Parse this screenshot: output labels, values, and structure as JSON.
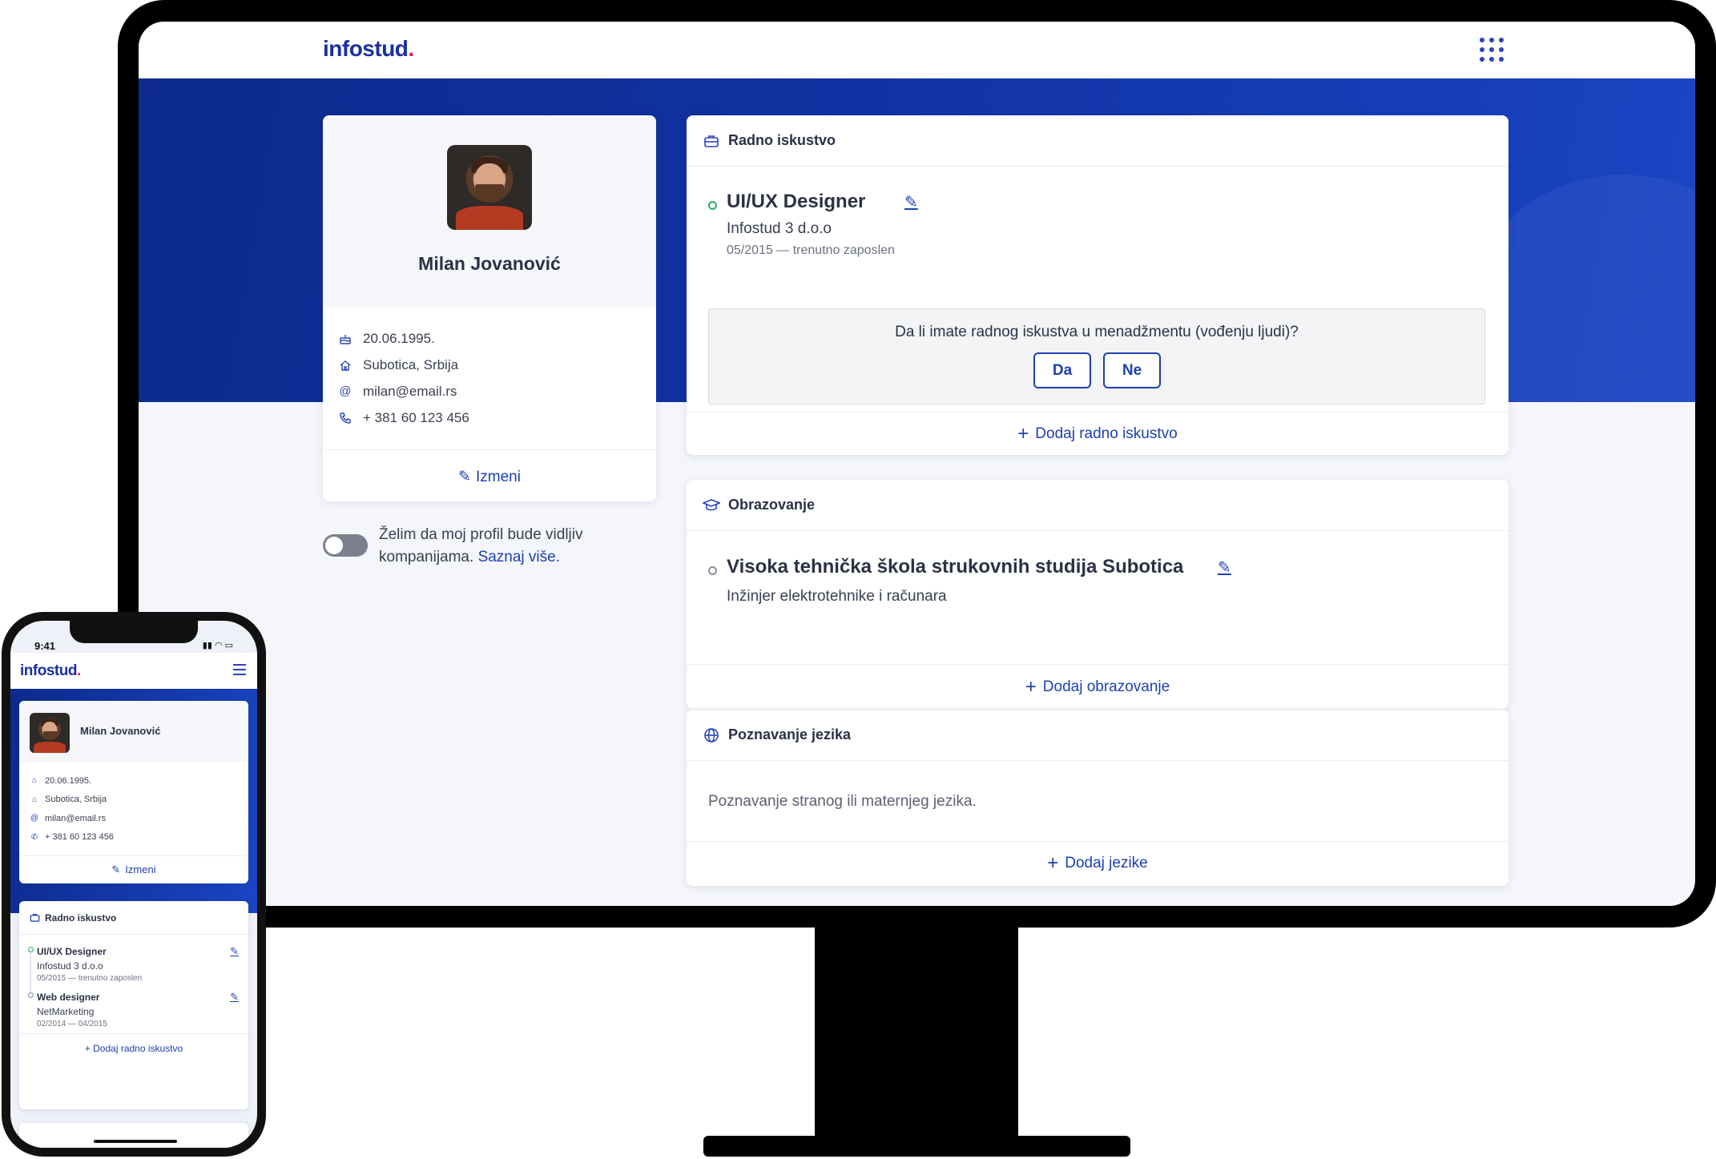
{
  "brand": {
    "logo_text": "infostud",
    "logo_dot": ".",
    "logo_color": "#1b2fa3",
    "dot_color": "#e5195a"
  },
  "colors": {
    "hero_start": "#0d2a8c",
    "hero_end": "#1a45c4",
    "link": "#1e3fb0",
    "current_bullet": "#29b061"
  },
  "desktop": {
    "topbar": {
      "menu_icon": "apps-grid-icon"
    },
    "profile": {
      "name": "Milan Jovanović",
      "avatar_icon": "profile-photo",
      "info": [
        {
          "icon": "cake-icon",
          "value": "20.06.1995."
        },
        {
          "icon": "home-icon",
          "value": "Subotica, Srbija"
        },
        {
          "icon": "at-icon",
          "value": "milan@email.rs"
        },
        {
          "icon": "phone-icon",
          "value": "+ 381 60 123 456"
        }
      ],
      "edit_label": "Izmeni"
    },
    "visibility": {
      "text": "Želim da moj profil bude vidljiv kompanijama.",
      "link": "Saznaj više.",
      "enabled": false
    },
    "work": {
      "heading": "Radno iskustvo",
      "icon": "briefcase-icon",
      "items": [
        {
          "title": "UI/UX Designer",
          "company": "Infostud 3 d.o.o",
          "period": "05/2015 — trenutno zaposlen"
        }
      ],
      "question": "Da li imate radnog iskustva u menadžmentu (vođenju ljudi)?",
      "yes_label": "Da",
      "no_label": "Ne",
      "add_label": "Dodaj radno iskustvo"
    },
    "education": {
      "heading": "Obrazovanje",
      "icon": "graduation-cap-icon",
      "items": [
        {
          "title": "Visoka tehnička škola strukovnih studija Subotica",
          "degree": "Inžinjer elektrotehnike i računara"
        }
      ],
      "add_label": "Dodaj obrazovanje"
    },
    "languages": {
      "heading": "Poznavanje jezika",
      "icon": "globe-icon",
      "placeholder": "Poznavanje stranog ili maternjeg jezika.",
      "add_label": "Dodaj jezike"
    }
  },
  "mobile": {
    "status": {
      "time": "9:41"
    },
    "profile": {
      "name": "Milan Jovanović",
      "info": [
        {
          "icon": "cake-icon",
          "value": "20.06.1995."
        },
        {
          "icon": "home-icon",
          "value": "Subotica, Srbija"
        },
        {
          "icon": "at-icon",
          "value": "milan@email.rs"
        },
        {
          "icon": "phone-icon",
          "value": "+ 381 60 123 456"
        }
      ],
      "edit_label": "Izmeni"
    },
    "work": {
      "heading": "Radno iskustvo",
      "items": [
        {
          "title": "UI/UX Designer",
          "company": "Infostud 3 d.o.o",
          "period": "05/2015 — trenutno zaposlen"
        },
        {
          "title": "Web designer",
          "company": "NetMarketing",
          "period": "02/2014 — 04/2015"
        }
      ],
      "add_label": "Dodaj radno iskustvo"
    }
  }
}
